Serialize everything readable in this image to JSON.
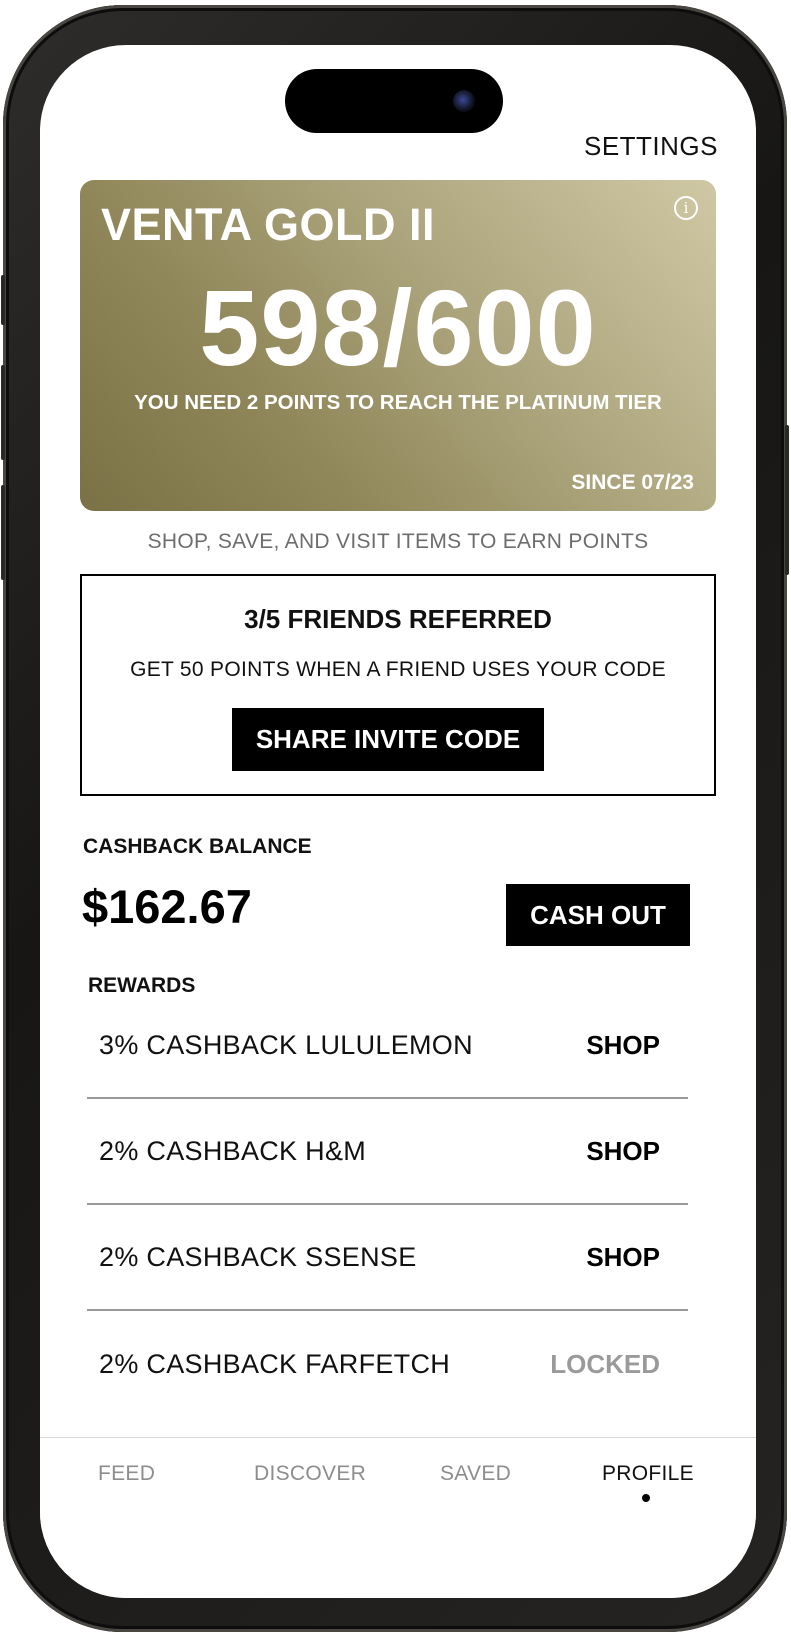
{
  "header": {
    "settings_label": "SETTINGS"
  },
  "tier_card": {
    "tier_name": "VENTA GOLD II",
    "points": "598/600",
    "points_current": 598,
    "points_target": 600,
    "message": "YOU NEED 2 POINTS TO REACH THE PLATINUM TIER",
    "since": "SINCE 07/23",
    "info_icon": "i",
    "colors": {
      "gradient_dark": "#7a7146",
      "gradient_light": "#cfc8a4"
    }
  },
  "earn_text": "SHOP, SAVE, AND VISIT ITEMS TO EARN POINTS",
  "referral": {
    "title": "3/5 FRIENDS REFERRED",
    "subtitle": "GET 50 POINTS WHEN A FRIEND USES YOUR CODE",
    "button_label": "SHARE INVITE CODE"
  },
  "cashback": {
    "label": "CASHBACK BALANCE",
    "amount": "$162.67",
    "button_label": "CASH OUT"
  },
  "rewards": {
    "label": "REWARDS",
    "items": [
      {
        "name": "3% CASHBACK LULULEMON",
        "action": "SHOP"
      },
      {
        "name": "2% CASHBACK H&M",
        "action": "SHOP"
      },
      {
        "name": "2% CASHBACK SSENSE",
        "action": "SHOP"
      },
      {
        "name": "2% CASHBACK FARFETCH",
        "action": "LOCKED"
      }
    ]
  },
  "tab_bar": {
    "tabs": [
      {
        "label": "FEED",
        "active": false
      },
      {
        "label": "DISCOVER",
        "active": false
      },
      {
        "label": "SAVED",
        "active": false
      },
      {
        "label": "PROFILE",
        "active": true
      }
    ]
  }
}
